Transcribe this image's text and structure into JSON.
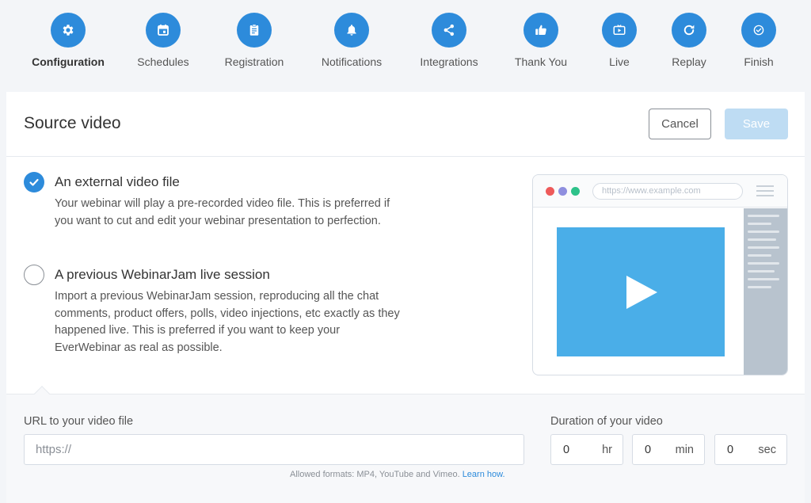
{
  "steps": [
    {
      "label": "Configuration",
      "icon": "gear-icon",
      "active": true
    },
    {
      "label": "Schedules",
      "icon": "calendar-icon"
    },
    {
      "label": "Registration",
      "icon": "clipboard-icon"
    },
    {
      "label": "Notifications",
      "icon": "bell-icon"
    },
    {
      "label": "Integrations",
      "icon": "share-icon"
    },
    {
      "label": "Thank You",
      "icon": "thumbs-up-icon"
    },
    {
      "label": "Live",
      "icon": "tv-play-icon"
    },
    {
      "label": "Replay",
      "icon": "refresh-icon"
    },
    {
      "label": "Finish",
      "icon": "check-circle-icon"
    }
  ],
  "header": {
    "title": "Source video",
    "cancel_label": "Cancel",
    "save_label": "Save"
  },
  "options": [
    {
      "title": "An external video file",
      "description": "Your webinar will play a pre-recorded video file. This is preferred if you want to cut and edit your webinar presentation to perfection.",
      "selected": true
    },
    {
      "title": "A previous WebinarJam live session",
      "description": "Import a previous WebinarJam session, reproducing all the chat comments, product offers, polls, video injections, etc exactly as they happened live. This is preferred if you want to keep your EverWebinar as real as possible.",
      "selected": false
    }
  ],
  "illustration": {
    "url_placeholder": "https://www.example.com"
  },
  "form": {
    "url_label": "URL to your video file",
    "url_placeholder": "https://",
    "url_value": "",
    "hint_text": "Allowed formats: MP4, YouTube and Vimeo.",
    "hint_link": "Learn how.",
    "duration_label": "Duration of your video",
    "duration": [
      {
        "value": "0",
        "unit": "hr"
      },
      {
        "value": "0",
        "unit": "min"
      },
      {
        "value": "0",
        "unit": "sec"
      }
    ]
  },
  "colors": {
    "accent": "#2d8bdb",
    "save_disabled": "#bedcf3",
    "video": "#4aaee8",
    "dot_red": "#ee5a5a",
    "dot_purple": "#8f8fdf",
    "dot_green": "#2ec28a"
  }
}
